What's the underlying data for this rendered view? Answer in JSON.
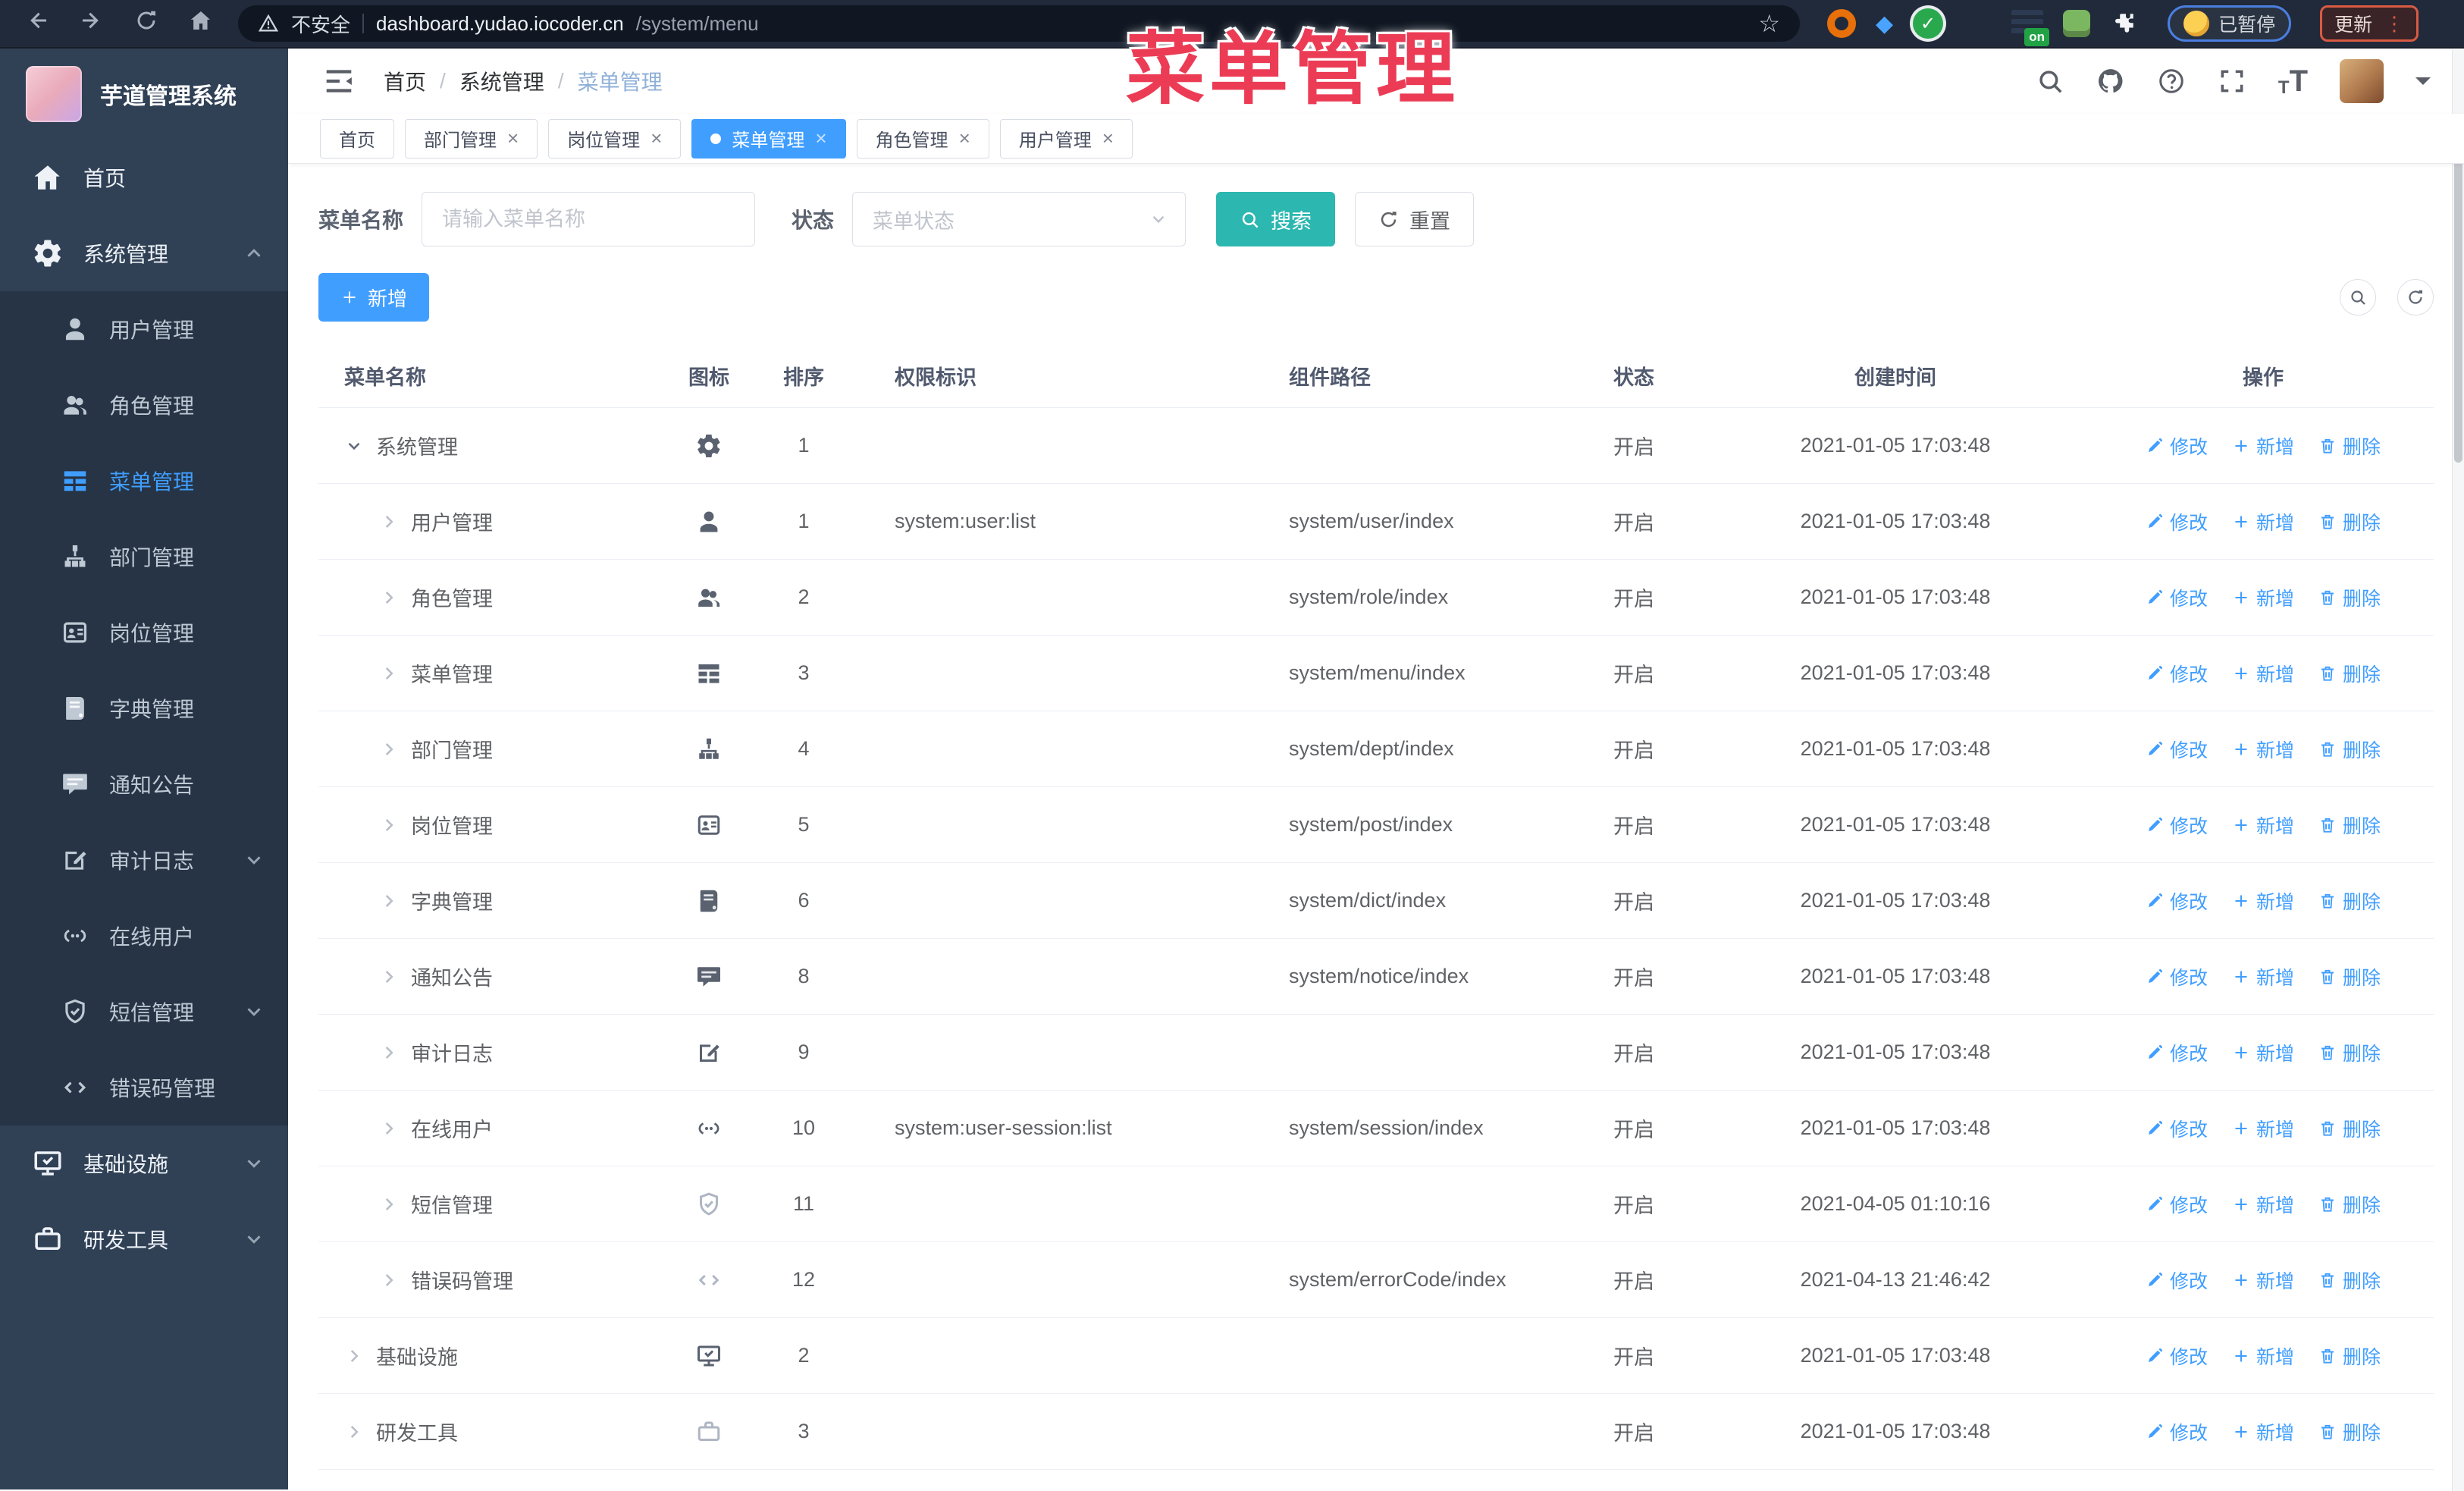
{
  "colors": {
    "accent_blue": "#409eff",
    "search_teal": "#2cb7b0",
    "overlay_pink": "#ec3c55",
    "update_border_red": "#d95b43",
    "paused_border_blue": "#4a7fe0",
    "sidebar_bg": "#304156",
    "submenu_bg": "#263445"
  },
  "browser": {
    "security_label": "不安全",
    "url_host": "dashboard.yudao.iocoder.cn",
    "url_path": "/system/menu",
    "nav_icons": [
      "back",
      "forward",
      "reload",
      "home"
    ],
    "extension_icons": [
      "orange-ring",
      "blue-gem",
      "green-check",
      "color-grid",
      "list-with-on-badge",
      "green-bot",
      "puzzle"
    ],
    "on_badge": "on",
    "paused_label": "已暂停",
    "update_label": "更新"
  },
  "overlay": {
    "title": "菜单管理"
  },
  "sidebar": {
    "app_title": "芋道管理系统",
    "items": [
      {
        "key": "home",
        "label": "首页",
        "icon": "home",
        "type": "top"
      },
      {
        "key": "system",
        "label": "系统管理",
        "icon": "gear",
        "type": "top",
        "chevron": "up",
        "open": true
      },
      {
        "key": "user",
        "label": "用户管理",
        "icon": "user",
        "type": "sub"
      },
      {
        "key": "role",
        "label": "角色管理",
        "icon": "users",
        "type": "sub"
      },
      {
        "key": "menu",
        "label": "菜单管理",
        "icon": "menu",
        "type": "sub",
        "active": true
      },
      {
        "key": "dept",
        "label": "部门管理",
        "icon": "tree",
        "type": "sub"
      },
      {
        "key": "post",
        "label": "岗位管理",
        "icon": "badge",
        "type": "sub"
      },
      {
        "key": "dict",
        "label": "字典管理",
        "icon": "book",
        "type": "sub"
      },
      {
        "key": "notice",
        "label": "通知公告",
        "icon": "message",
        "type": "sub"
      },
      {
        "key": "audit-log",
        "label": "审计日志",
        "icon": "edit",
        "type": "sub",
        "chevron": "down"
      },
      {
        "key": "online-user",
        "label": "在线用户",
        "icon": "link",
        "type": "sub"
      },
      {
        "key": "sms",
        "label": "短信管理",
        "icon": "shield",
        "type": "sub",
        "chevron": "down"
      },
      {
        "key": "error-code",
        "label": "错误码管理",
        "icon": "code",
        "type": "sub"
      },
      {
        "key": "infra",
        "label": "基础设施",
        "icon": "monitor",
        "type": "top",
        "chevron": "down"
      },
      {
        "key": "dev-tool",
        "label": "研发工具",
        "icon": "tool",
        "type": "top",
        "chevron": "down"
      }
    ]
  },
  "header": {
    "breadcrumb": [
      "首页",
      "系统管理",
      "菜单管理"
    ],
    "separator": "/",
    "right_icons": [
      "search",
      "github",
      "help",
      "fullscreen",
      "font-size",
      "avatar",
      "caret-down"
    ]
  },
  "tabs": [
    {
      "key": "home",
      "label": "首页",
      "closable": false,
      "active": false
    },
    {
      "key": "dept",
      "label": "部门管理",
      "closable": true,
      "active": false
    },
    {
      "key": "post",
      "label": "岗位管理",
      "closable": true,
      "active": false
    },
    {
      "key": "menu",
      "label": "菜单管理",
      "closable": true,
      "active": true
    },
    {
      "key": "role",
      "label": "角色管理",
      "closable": true,
      "active": false
    },
    {
      "key": "user",
      "label": "用户管理",
      "closable": true,
      "active": false
    }
  ],
  "filters": {
    "name_label": "菜单名称",
    "name_placeholder": "请输入菜单名称",
    "status_label": "状态",
    "status_placeholder": "菜单状态",
    "search_label": "搜索",
    "reset_label": "重置"
  },
  "toolbar": {
    "add_label": "新增"
  },
  "table": {
    "columns": [
      "菜单名称",
      "图标",
      "排序",
      "权限标识",
      "组件路径",
      "状态",
      "创建时间",
      "操作"
    ],
    "actions": {
      "edit": "修改",
      "add": "新增",
      "delete": "删除"
    },
    "rows": [
      {
        "name": "系统管理",
        "level": 0,
        "expanded": true,
        "icon": "gear",
        "sort": "1",
        "perm": "",
        "path": "",
        "status": "开启",
        "created": "2021-01-05 17:03:48"
      },
      {
        "name": "用户管理",
        "level": 1,
        "icon": "user",
        "sort": "1",
        "perm": "system:user:list",
        "path": "system/user/index",
        "status": "开启",
        "created": "2021-01-05 17:03:48"
      },
      {
        "name": "角色管理",
        "level": 1,
        "icon": "users",
        "sort": "2",
        "perm": "",
        "path": "system/role/index",
        "status": "开启",
        "created": "2021-01-05 17:03:48"
      },
      {
        "name": "菜单管理",
        "level": 1,
        "icon": "menu",
        "sort": "3",
        "perm": "",
        "path": "system/menu/index",
        "status": "开启",
        "created": "2021-01-05 17:03:48"
      },
      {
        "name": "部门管理",
        "level": 1,
        "icon": "tree",
        "sort": "4",
        "perm": "",
        "path": "system/dept/index",
        "status": "开启",
        "created": "2021-01-05 17:03:48"
      },
      {
        "name": "岗位管理",
        "level": 1,
        "icon": "badge",
        "sort": "5",
        "perm": "",
        "path": "system/post/index",
        "status": "开启",
        "created": "2021-01-05 17:03:48"
      },
      {
        "name": "字典管理",
        "level": 1,
        "icon": "book",
        "sort": "6",
        "perm": "",
        "path": "system/dict/index",
        "status": "开启",
        "created": "2021-01-05 17:03:48"
      },
      {
        "name": "通知公告",
        "level": 1,
        "icon": "message",
        "sort": "8",
        "perm": "",
        "path": "system/notice/index",
        "status": "开启",
        "created": "2021-01-05 17:03:48"
      },
      {
        "name": "审计日志",
        "level": 1,
        "icon": "edit",
        "sort": "9",
        "perm": "",
        "path": "",
        "status": "开启",
        "created": "2021-01-05 17:03:48"
      },
      {
        "name": "在线用户",
        "level": 1,
        "icon": "link",
        "sort": "10",
        "perm": "system:user-session:list",
        "path": "system/session/index",
        "status": "开启",
        "created": "2021-01-05 17:03:48"
      },
      {
        "name": "短信管理",
        "level": 1,
        "icon": "shield",
        "icon_light": true,
        "sort": "11",
        "perm": "",
        "path": "",
        "status": "开启",
        "created": "2021-04-05 01:10:16"
      },
      {
        "name": "错误码管理",
        "level": 1,
        "icon": "code",
        "icon_light": true,
        "sort": "12",
        "perm": "",
        "path": "system/errorCode/index",
        "status": "开启",
        "created": "2021-04-13 21:46:42"
      },
      {
        "name": "基础设施",
        "level": 0,
        "icon": "monitor",
        "sort": "2",
        "perm": "",
        "path": "",
        "status": "开启",
        "created": "2021-01-05 17:03:48"
      },
      {
        "name": "研发工具",
        "level": 0,
        "icon": "tool",
        "icon_light": true,
        "sort": "3",
        "perm": "",
        "path": "",
        "status": "开启",
        "created": "2021-01-05 17:03:48"
      }
    ]
  }
}
